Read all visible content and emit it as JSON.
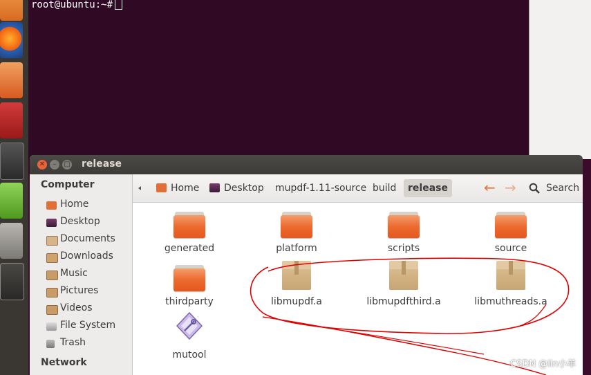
{
  "terminal": {
    "prompt": "root@ubuntu:~#"
  },
  "window": {
    "title": "release"
  },
  "sidebar": {
    "computer_heading": "Computer",
    "items": [
      {
        "label": "Home",
        "icon": "home-folder-icon"
      },
      {
        "label": "Desktop",
        "icon": "desktop-icon"
      },
      {
        "label": "Documents",
        "icon": "documents-icon"
      },
      {
        "label": "Downloads",
        "icon": "downloads-icon"
      },
      {
        "label": "Music",
        "icon": "music-icon"
      },
      {
        "label": "Pictures",
        "icon": "pictures-icon"
      },
      {
        "label": "Videos",
        "icon": "videos-icon"
      },
      {
        "label": "File System",
        "icon": "filesystem-icon"
      },
      {
        "label": "Trash",
        "icon": "trash-icon"
      }
    ],
    "network_heading": "Network"
  },
  "breadcrumb": [
    "Home",
    "Desktop",
    "mupdf-1.11-source",
    "build",
    "release"
  ],
  "toolbar": {
    "back_arrow": "←",
    "forward_arrow": "→",
    "search_label": "Search"
  },
  "files": [
    {
      "name": "generated",
      "type": "folder"
    },
    {
      "name": "platform",
      "type": "folder"
    },
    {
      "name": "scripts",
      "type": "folder"
    },
    {
      "name": "source",
      "type": "folder"
    },
    {
      "name": "thirdparty",
      "type": "folder"
    },
    {
      "name": "libmupdf.a",
      "type": "archive"
    },
    {
      "name": "libmupdfthird.a",
      "type": "archive"
    },
    {
      "name": "libmuthreads.a",
      "type": "archive"
    },
    {
      "name": "mutool",
      "type": "executable"
    }
  ],
  "watermark": "CSDN @lin小羊",
  "colors": {
    "terminal_bg": "#300a24",
    "accent_orange": "#e8733a",
    "annotation_red": "#e00000"
  }
}
